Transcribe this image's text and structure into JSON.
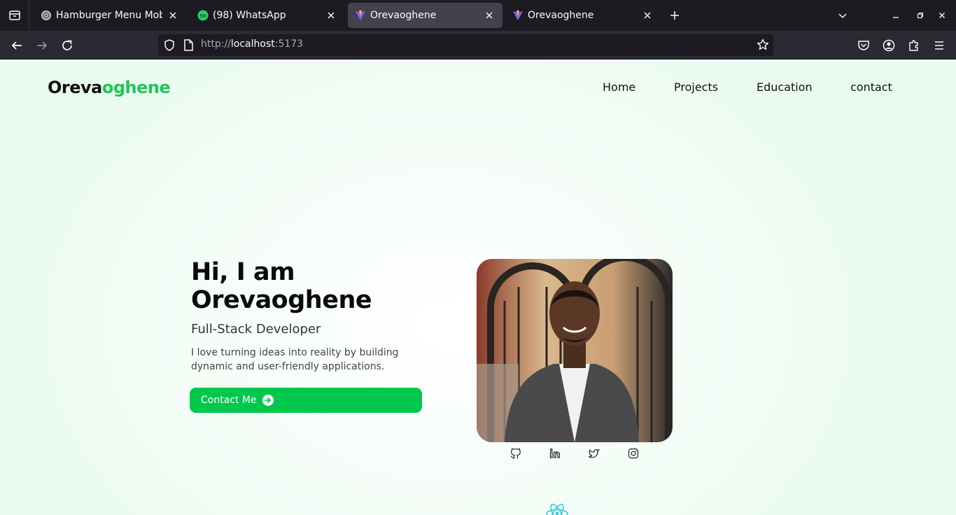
{
  "browser": {
    "tabs": [
      {
        "title": "Hamburger Menu Mobile",
        "favicon": "codepen-icon",
        "active": false
      },
      {
        "title": "(98) WhatsApp",
        "favicon": "whatsapp-icon",
        "badge": "98",
        "active": false
      },
      {
        "title": "Orevaoghene",
        "favicon": "vite-icon",
        "active": true
      },
      {
        "title": "Orevaoghene",
        "favicon": "vite-icon",
        "active": false
      }
    ],
    "url_scheme": "http://",
    "url_host": "localhost",
    "url_port": ":5173"
  },
  "site": {
    "logo_part1": "Oreva",
    "logo_part2": "oghene",
    "nav": [
      "Home",
      "Projects",
      "Education",
      "contact"
    ],
    "hero": {
      "title_line1": "Hi, I am",
      "title_line2": "Orevaoghene",
      "role": "Full-Stack Developer",
      "description": "I love turning ideas into reality by building dynamic and user-friendly applications.",
      "cta_label": "Contact Me"
    },
    "socials": [
      "github-icon",
      "linkedin-icon",
      "twitter-icon",
      "instagram-icon"
    ]
  },
  "colors": {
    "accent_green": "#00c84d",
    "logo_green": "#1fc655",
    "chrome_dark": "#1c1b22"
  }
}
